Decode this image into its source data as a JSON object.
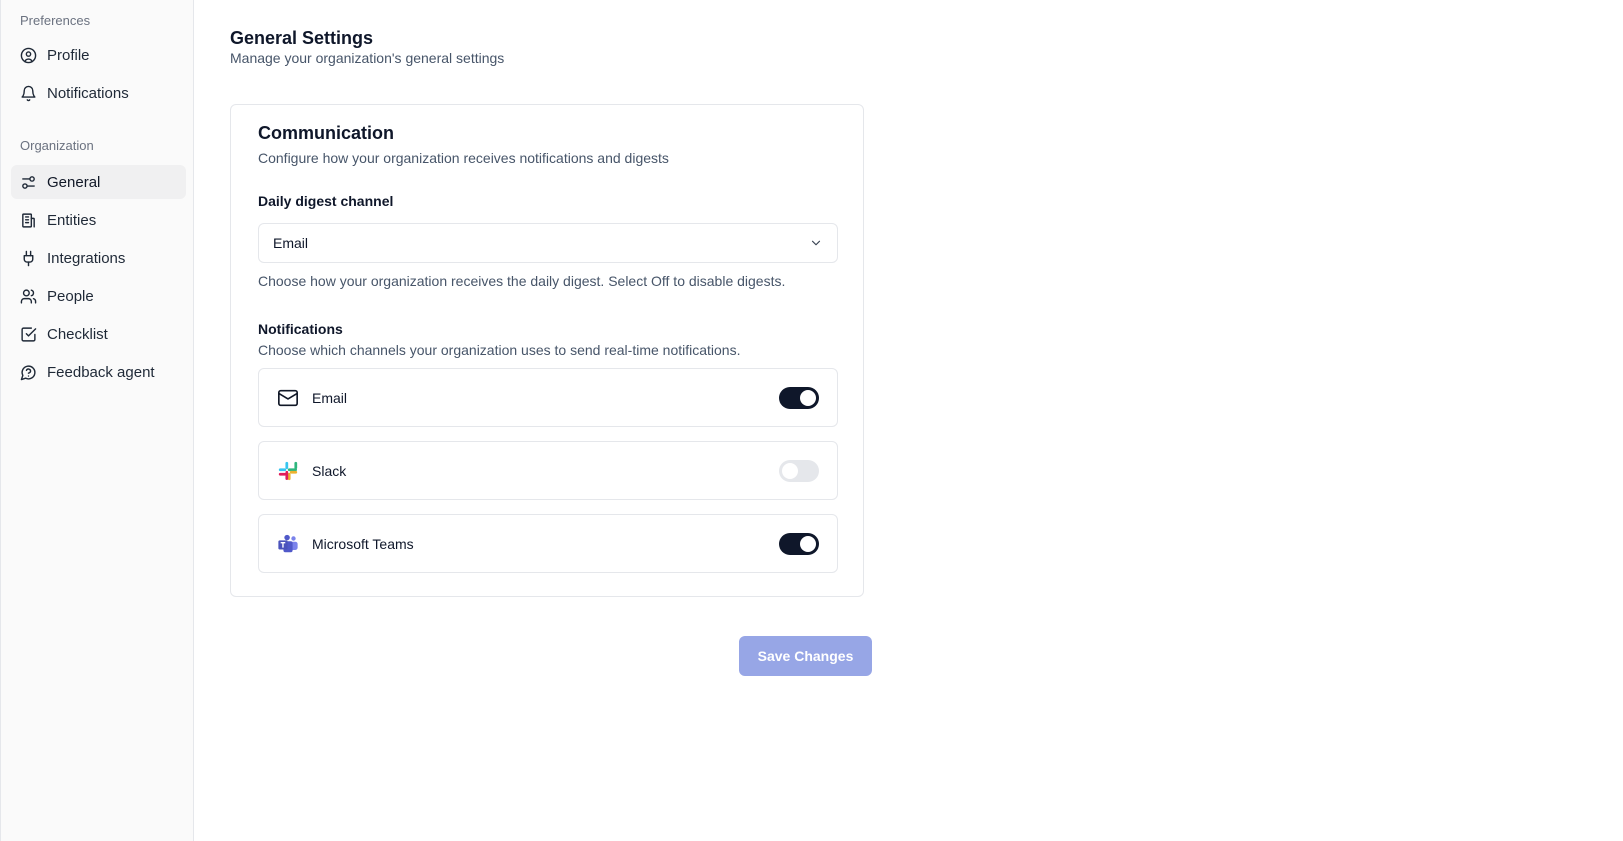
{
  "sidebar": {
    "preferences_label": "Preferences",
    "organization_label": "Organization",
    "preferences_items": [
      {
        "label": "Profile",
        "icon": "user-circle-icon"
      },
      {
        "label": "Notifications",
        "icon": "bell-icon"
      }
    ],
    "organization_items": [
      {
        "label": "General",
        "icon": "sliders-icon",
        "active": true
      },
      {
        "label": "Entities",
        "icon": "building-icon"
      },
      {
        "label": "Integrations",
        "icon": "plug-icon"
      },
      {
        "label": "People",
        "icon": "users-icon"
      },
      {
        "label": "Checklist",
        "icon": "checkbox-icon"
      },
      {
        "label": "Feedback agent",
        "icon": "message-question-icon"
      }
    ]
  },
  "header": {
    "title": "General Settings",
    "subtitle": "Manage your organization's general settings"
  },
  "communication": {
    "title": "Communication",
    "subtitle": "Configure how your organization receives notifications and digests",
    "digest_label": "Daily digest channel",
    "digest_value": "Email",
    "digest_help": "Choose how your organization receives the daily digest. Select Off to disable digests.",
    "notifications_title": "Notifications",
    "notifications_sub": "Choose which channels your organization uses to send real-time notifications.",
    "channels": [
      {
        "label": "Email",
        "icon": "mail-icon",
        "enabled": true
      },
      {
        "label": "Slack",
        "icon": "slack-icon",
        "enabled": false
      },
      {
        "label": "Microsoft Teams",
        "icon": "teams-icon",
        "enabled": true
      }
    ]
  },
  "actions": {
    "save_label": "Save Changes"
  },
  "colors": {
    "toggle_on": "#0f172a",
    "toggle_off": "#e5e7eb",
    "save_button": "#97a6e6"
  }
}
